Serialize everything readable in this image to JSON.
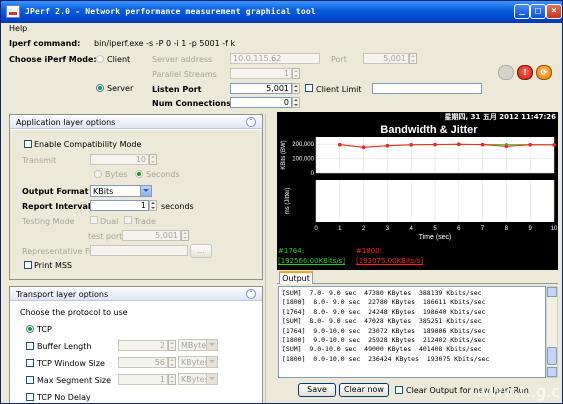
{
  "window": {
    "title": "JPerf 2.0 - Network performance measurement graphical tool"
  },
  "menu": {
    "help": "Help"
  },
  "top": {
    "iperf_command_label": "Iperf command:",
    "iperf_command_value": "bin/iperf.exe -s -P 0 -i 1 -p 5001 -f k",
    "mode_label": "Choose iPerf Mode:",
    "client_label": "Client",
    "server_label": "Server",
    "server_address_label": "Server address",
    "server_address_value": "10.0.115.62",
    "port_label": "Port",
    "port_value": "5,001",
    "parallel_streams_label": "Parallel Streams",
    "parallel_streams_value": "1",
    "listen_port_label": "Listen Port",
    "listen_port_value": "5,001",
    "client_limit_label": "Client Limit",
    "num_connections_label": "Num Connections",
    "num_connections_value": "0"
  },
  "app_panel": {
    "title": "Application layer options",
    "enable_compat": "Enable Compatibility Mode",
    "transmit_label": "Transmit",
    "transmit_value": "10",
    "bytes_label": "Bytes",
    "seconds_label": "Seconds",
    "output_format_label": "Output Format",
    "output_format_value": "KBits",
    "report_interval_label": "Report Interval",
    "report_interval_value": "1",
    "report_interval_unit": "seconds",
    "testing_mode_label": "Testing Mode",
    "dual_label": "Dual",
    "trade_label": "Trade",
    "test_port_label": "test port",
    "test_port_value": "5,001",
    "rep_file_label": "Representative File",
    "rep_file_button": "...",
    "print_mss": "Print MSS"
  },
  "transport_panel": {
    "title": "Transport layer options",
    "choose_protocol": "Choose the protocol to use",
    "tcp_label": "TCP",
    "buffer_length_label": "Buffer Length",
    "buffer_length_value": "2",
    "buffer_length_unit": "MBytes",
    "window_size_label": "TCP Window Size",
    "window_size_value": "56",
    "window_size_unit": "KBytes",
    "segment_size_label": "Max Segment Size",
    "segment_size_value": "1",
    "segment_size_unit": "KBytes",
    "no_delay_label": "TCP No Delay"
  },
  "chart": {
    "timestamp": "星期四, 31 五月 2012 11:47:26",
    "legend_1764": "#1764:",
    "legend_1764_value": "[192566.00KBits/s]",
    "legend_1800": "#1800:",
    "legend_1800_value": "[193075.00KBits/s]"
  },
  "chart_data": [
    {
      "type": "line",
      "title": "Bandwidth & Jitter",
      "ylabel": "KBits (BW)",
      "xlabel": "Time (sec)",
      "x": [
        1,
        2,
        3,
        4,
        5,
        6,
        7,
        8,
        9,
        10
      ],
      "ylim": [
        0,
        250000
      ],
      "yticks": [
        "200,000",
        "100,000",
        "0"
      ],
      "series": [
        {
          "name": "#1764",
          "color": "#22cc22",
          "values": [
            196000,
            178000,
            190000,
            195000,
            197000,
            199000,
            198000,
            196000,
            197000,
            196000
          ]
        },
        {
          "name": "#1800",
          "color": "#ff2222",
          "values": [
            197000,
            179000,
            189000,
            196000,
            198000,
            200000,
            197000,
            185000,
            196000,
            195000
          ]
        }
      ]
    },
    {
      "type": "line",
      "ylabel": "ms (Jitter)",
      "xlabel": "Time (sec)",
      "x": [
        0,
        1,
        2,
        3,
        4,
        5,
        6,
        7,
        8,
        9,
        10
      ],
      "xticks": [
        "0",
        "1",
        "2",
        "3",
        "4",
        "5",
        "6",
        "7",
        "8",
        "9",
        "10"
      ],
      "yticks": [
        "1.0",
        "0.5",
        "0.0"
      ],
      "series": []
    }
  ],
  "tabs": {
    "output": "Output"
  },
  "output_lines": [
    "[SUM]  7.0- 9.0 sec  47380 KBytes  388139 Kbits/sec",
    "[1800]  8.0- 9.0 sec  22780 KBytes  186611 Kbits/sec",
    "[1764]  8.0- 9.0 sec  24248 KBytes  198640 Kbits/sec",
    "[SUM]  8.0- 9.0 sec  47028 KBytes  385251 Kbits/sec",
    "[1764]  9.0-10.0 sec  23072 KBytes  189006 Kbits/sec",
    "[1800]  9.0-10.0 sec  25928 KBytes  212402 Kbits/sec",
    "[SUM]  9.0-10.0 sec  49000 KBytes  401408 Kbits/sec",
    "[1800]  0.0-10.0 sec  236424 KBytes  193075 Kbits/sec"
  ],
  "bottom": {
    "save_label": "Save",
    "clear_label": "Clear now",
    "clear_output_label": "Clear Output for new Iperf Run"
  },
  "watermark": "www.t..g.c"
}
